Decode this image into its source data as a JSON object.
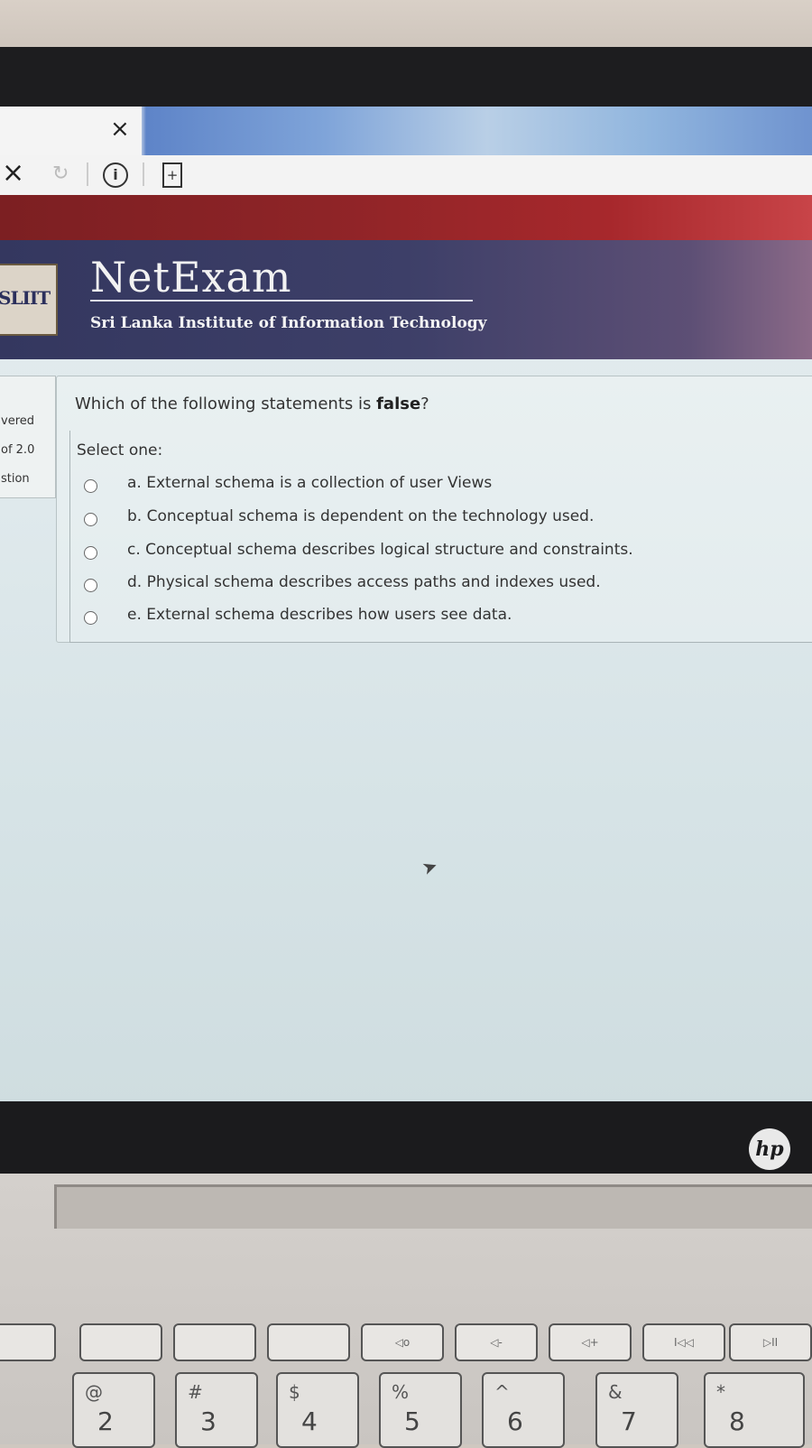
{
  "browser": {
    "tab_close_glyph": "×",
    "nav_close_glyph": "×",
    "nav_reload_glyph": "↻",
    "info_glyph": "i",
    "doc_glyph": "+"
  },
  "site": {
    "brand": "NetExam",
    "logo_text": "SLIIT",
    "institute": "Sri Lanka Institute of Information Technology"
  },
  "question_info": {
    "line1": "vered",
    "line2": "of 2.0",
    "line3": "stion"
  },
  "question": {
    "text_prefix": "Which of the following statements is ",
    "text_bold": "false",
    "text_suffix": "?",
    "select_label": "Select one:",
    "options": [
      {
        "label": "a. External schema is a collection of user Views"
      },
      {
        "label": "b. Conceptual schema is dependent on the technology used."
      },
      {
        "label": "c. Conceptual schema describes logical structure and constraints."
      },
      {
        "label": "d. Physical schema describes access paths and indexes used."
      },
      {
        "label": "e. External schema describes how users see data."
      }
    ]
  },
  "laptop": {
    "logo": "hp",
    "fkeys": [
      "",
      "",
      "",
      "",
      "◁o",
      "◁-",
      "◁+",
      "I◁◁",
      "▷II"
    ],
    "numkeys": [
      {
        "top": "@",
        "bot": "2"
      },
      {
        "top": "#",
        "bot": "3"
      },
      {
        "top": "$",
        "bot": "4"
      },
      {
        "top": "%",
        "bot": "5"
      },
      {
        "top": "^",
        "bot": "6"
      },
      {
        "top": "&",
        "bot": "7"
      },
      {
        "top": "*",
        "bot": "8"
      }
    ]
  },
  "colors": {
    "banner": "#3d3f68",
    "redband": "#8e2427",
    "card_bg": "#e6eef0"
  }
}
